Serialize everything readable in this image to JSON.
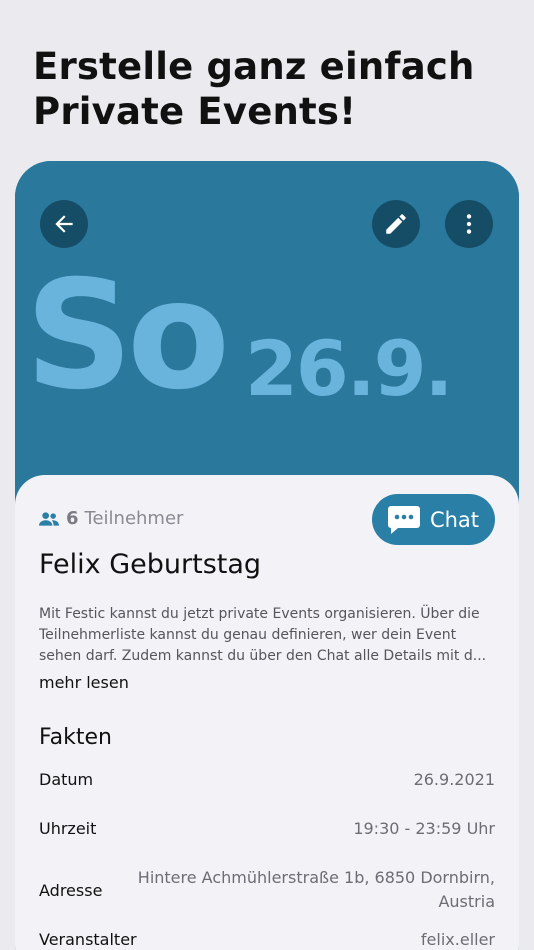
{
  "headline": {
    "line1": "Erstelle ganz einfach",
    "line2": "Private Events!"
  },
  "event": {
    "weekday": "So",
    "date": "26.9.",
    "participants_count": "6",
    "participants_label": "Teilnehmer",
    "chat_label": "Chat",
    "title": "Felix Geburtstag",
    "description": "Mit Festic kannst du jetzt private Events organisieren. Über die Teilnehmerliste kannst du genau definieren, wer dein Event sehen darf. Zudem kannst du über den Chat alle Details mit d...",
    "read_more": "mehr lesen"
  },
  "facts": {
    "title": "Fakten",
    "date_label": "Datum",
    "date_value": "26.9.2021",
    "time_label": "Uhrzeit",
    "time_value": "19:30 - 23:59 Uhr",
    "address_label": "Adresse",
    "address_value": "Hintere Achmühlerstraße 1b, 6850 Dornbirn, Austria",
    "host_label": "Veranstalter",
    "host_value": "felix.eller"
  },
  "icons": {
    "back": "arrow-left-icon",
    "edit": "pencil-icon",
    "more": "more-vertical-icon",
    "participants": "people-icon",
    "chat": "chat-bubble-icon"
  },
  "colors": {
    "hero_background": "#2a789c",
    "hero_text": "#69b4dc",
    "round_button": "#164d66",
    "chat_button": "#2a7fa7",
    "sheet_background": "#f3f3f7",
    "page_background": "#ebebef"
  }
}
